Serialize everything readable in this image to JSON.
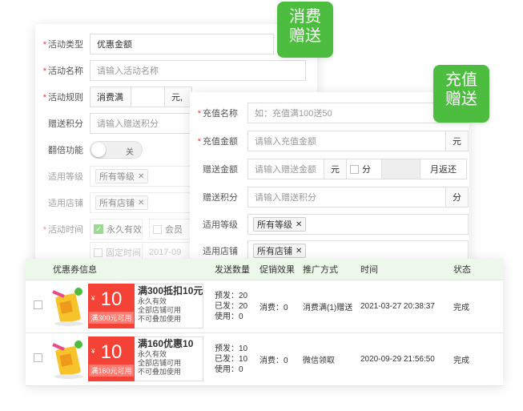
{
  "badges": {
    "consume": "消费\n赠送",
    "recharge": "充值\n赠送"
  },
  "back_form": {
    "activity_type": {
      "label": "活动类型",
      "value": "优惠金额"
    },
    "activity_name": {
      "label": "活动名称",
      "placeholder": "请输入活动名称"
    },
    "activity_rule": {
      "label": "活动规则",
      "prefix": "消费满",
      "unit": "元,"
    },
    "bonus_points": {
      "label": "赠送积分",
      "placeholder": "请输入赠送积分"
    },
    "double_feature": {
      "label": "翻倍功能",
      "toggle_text": "关"
    },
    "level": {
      "label": "适用等级",
      "tag": "所有等级"
    },
    "store": {
      "label": "适用店铺",
      "tag": "所有店铺"
    },
    "time": {
      "label": "活动时间",
      "option1": "永久有效",
      "option2": "会员",
      "option3": "固定时间",
      "date": "2017-09"
    }
  },
  "front_form": {
    "recharge_name": {
      "label": "充值名称",
      "placeholder": "如：充值满100送50"
    },
    "recharge_amount": {
      "label": "充值金额",
      "placeholder": "请输入充值金额",
      "unit": "元"
    },
    "bonus_amount": {
      "label": "赠送金额",
      "placeholder": "请输入赠送金额",
      "unit": "元",
      "unit2": "分",
      "suffix": "月返还"
    },
    "bonus_points": {
      "label": "赠送积分",
      "placeholder": "请输入赠送积分",
      "unit": "分"
    },
    "level": {
      "label": "适用等级",
      "tag": "所有等级"
    },
    "store": {
      "label": "适用店铺",
      "tag": "所有店铺"
    }
  },
  "table": {
    "headers": [
      "优惠券信息",
      "发送数量",
      "促销效果",
      "推广方式",
      "时间",
      "状态"
    ],
    "rows": [
      {
        "amount": "10",
        "yen": "¥",
        "cond": "满300元可用",
        "title": "满300抵扣10元",
        "line1": "永久有效",
        "line2": "全部店铺可用",
        "line3": "不可叠加使用",
        "sent": "预发：20",
        "issued": "已发：20",
        "used": "使用：0",
        "effect": "消费：0",
        "promo": "消费满(1)赠送",
        "time": "2021-03-27 20:38:37",
        "status": "完成"
      },
      {
        "amount": "10",
        "yen": "¥",
        "cond": "满160元可用",
        "title": "满160优惠10",
        "line1": "永久有效",
        "line2": "全部店铺可用",
        "line3": "不可叠加使用",
        "sent": "预发：10",
        "issued": "已发：10",
        "used": "使用：0",
        "effect": "消费：0",
        "promo": "微信领取",
        "time": "2020-09-29 21:56:50",
        "status": "完成"
      }
    ]
  },
  "colors": {
    "accent": "#4cbd3e",
    "coupon_red": "#f44336",
    "header_bg": "#ecf8ea"
  }
}
